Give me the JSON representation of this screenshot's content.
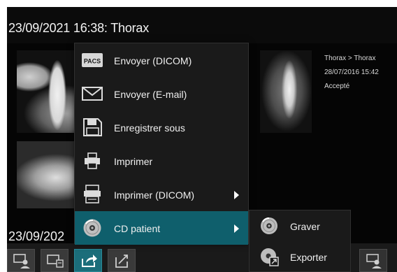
{
  "study_header": {
    "title": "23/09/2021 16:38:  Thorax"
  },
  "second_study": {
    "title": "23/09/202"
  },
  "image_meta": {
    "path": "Thorax > Thorax",
    "date": "28/07/2016 15:42",
    "status": "Accepté"
  },
  "context_menu": {
    "items": [
      {
        "label": "Envoyer (DICOM)",
        "icon": "pacs-icon",
        "badge": "PACS"
      },
      {
        "label": "Envoyer (E-mail)",
        "icon": "envelope-icon"
      },
      {
        "label": "Enregistrer sous",
        "icon": "floppy-disk-icon"
      },
      {
        "label": "Imprimer",
        "icon": "printer-icon"
      },
      {
        "label": "Imprimer (DICOM)",
        "icon": "dicom-printer-icon",
        "has_submenu": true
      },
      {
        "label": "CD patient",
        "icon": "cd-icon",
        "has_submenu": true,
        "highlighted": true
      }
    ]
  },
  "submenu": {
    "items": [
      {
        "label": "Graver",
        "icon": "burn-disc-icon"
      },
      {
        "label": "Exporter",
        "icon": "export-disc-icon"
      }
    ]
  },
  "toolbar": {
    "buttons": [
      {
        "icon": "patient-transfer-icon"
      },
      {
        "icon": "screen-print-icon"
      },
      {
        "icon": "share-icon",
        "active": true
      },
      {
        "icon": "export-document-icon"
      },
      {
        "icon": "user-settings-icon"
      }
    ]
  },
  "colors": {
    "highlight": "#0f5f6c",
    "active_button": "#1b6d7a",
    "menu_background": "#1a1a1a",
    "app_background": "#050505"
  }
}
